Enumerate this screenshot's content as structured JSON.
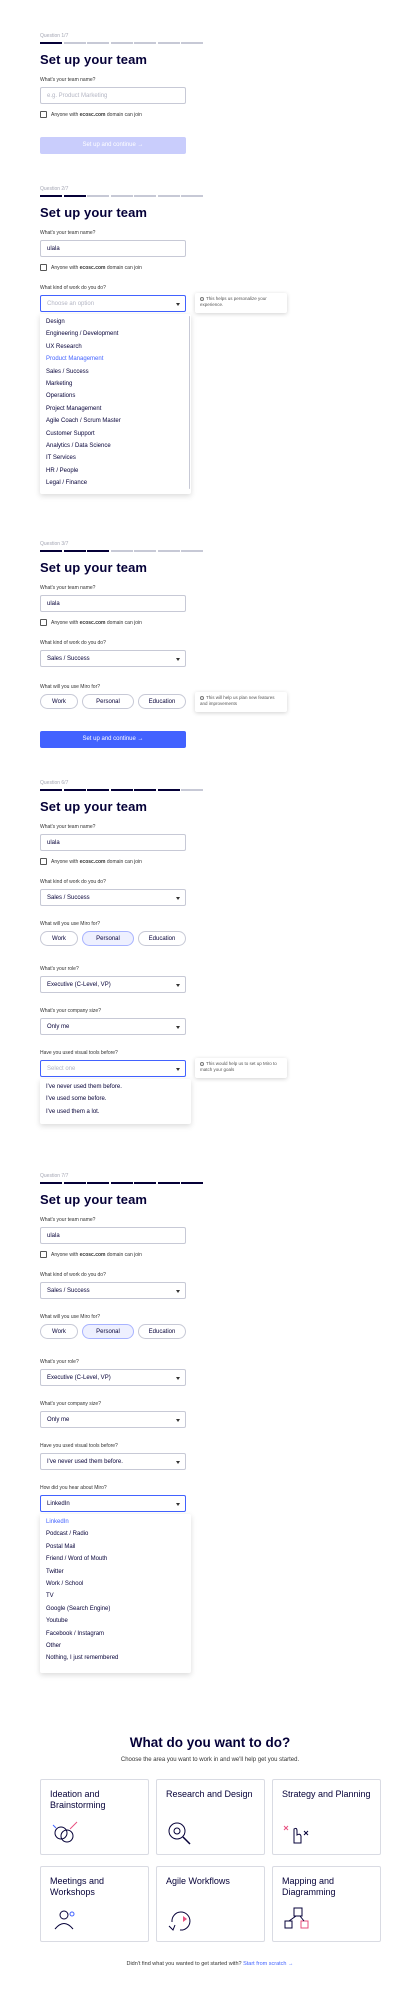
{
  "common": {
    "title": "Set up your team",
    "team_name_label": "What's your team name?",
    "team_name_placeholder": "e.g. Product Marketing",
    "team_name_value": "ulala",
    "domain_prefix": "Anyone with",
    "domain": "ecosc.com",
    "domain_suffix": "domain can join",
    "work_label": "What kind of work do you do?",
    "work_placeholder": "Choose an option",
    "work_value": "Sales / Success",
    "use_label": "What will you use Miro for?",
    "use_options": [
      "Work",
      "Personal",
      "Education"
    ],
    "role_label": "What's your role?",
    "role_value": "Executive (C-Level, VP)",
    "size_label": "What's your company size?",
    "size_value": "Only me",
    "tools_label": "Have you used visual tools before?",
    "tools_placeholder": "Select one",
    "tools_value": "I've never used them before.",
    "hear_label": "How did you hear about Miro?",
    "hear_value": "LinkedIn",
    "continue_label": "Set up and continue →"
  },
  "steps": {
    "s1": {
      "question": "Question 1/7",
      "progress": 1
    },
    "s2": {
      "question": "Question 2/7",
      "progress": 2
    },
    "s3": {
      "question": "Question 3/7",
      "progress": 3
    },
    "s4": {
      "question": "Question 6/7",
      "progress": 6
    },
    "s5": {
      "question": "Question 7/7",
      "progress": 7
    }
  },
  "work_options": [
    "Design",
    "Engineering / Development",
    "UX Research",
    "Product Management",
    "Sales / Success",
    "Marketing",
    "Operations",
    "Project Management",
    "Agile Coach / Scrum Master",
    "Customer Support",
    "Analytics / Data Science",
    "IT Services",
    "HR / People",
    "Legal / Finance"
  ],
  "tools_options": [
    "I've never used them before.",
    "I've used some before.",
    "I've used them a lot."
  ],
  "hear_options": [
    "LinkedIn",
    "Podcast / Radio",
    "Postal Mail",
    "Friend / Word of Mouth",
    "Twitter",
    "Work / School",
    "TV",
    "Google (Search Engine)",
    "Youtube",
    "Facebook / Instagram",
    "Other",
    "Nothing, I just remembered"
  ],
  "tooltips": {
    "work": "This helps us personalize your experience.",
    "use": "This will help us plan new features and improvements",
    "tools": "This would help us to set up Miro to match your goals"
  },
  "what_to_do": {
    "title": "What do you want to do?",
    "subtitle": "Choose the area you want to work in and we'll help get you started.",
    "cards": [
      {
        "title": "Ideation and Brainstorming",
        "icon": "ideation-icon"
      },
      {
        "title": "Research and Design",
        "icon": "research-icon"
      },
      {
        "title": "Strategy and Planning",
        "icon": "strategy-icon"
      },
      {
        "title": "Meetings and Workshops",
        "icon": "meetings-icon"
      },
      {
        "title": "Agile Workflows",
        "icon": "agile-icon"
      },
      {
        "title": "Mapping and Diagramming",
        "icon": "mapping-icon"
      }
    ],
    "footer_text": "Didn't find what you wanted to get started with?",
    "footer_link": "Start from scratch →"
  },
  "colors": {
    "accent": "#4262ff",
    "ink": "#050038",
    "disabled": "#c9cdfc",
    "highlight": "#e94f7e"
  }
}
